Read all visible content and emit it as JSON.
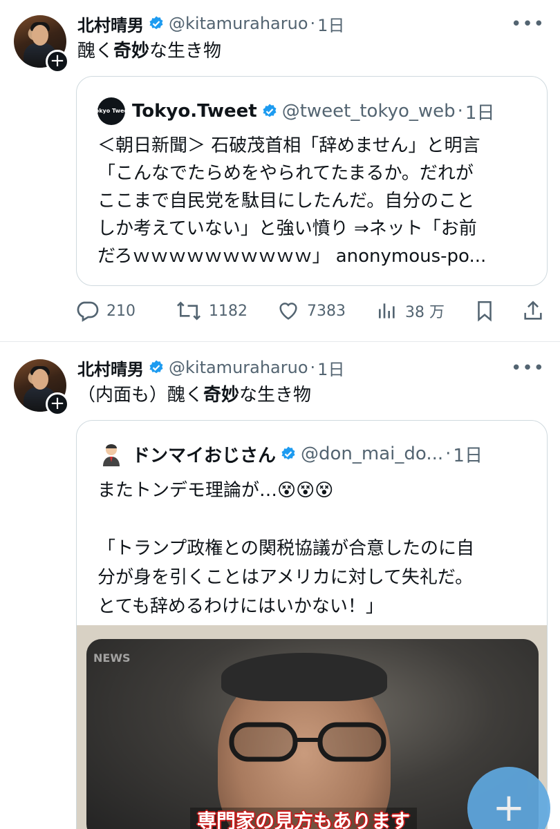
{
  "tweets": [
    {
      "author_name": "北村晴男",
      "handle": "@kitamuraharuo",
      "separator": "·",
      "time": "1日",
      "more": "•••",
      "text_a": "醜く",
      "text_b": "奇妙",
      "text_c": "な生き物",
      "quote": {
        "author_name": "Tokyo.Tweet",
        "avatar_text": "Tokyo Tweet",
        "handle": "@tweet_tokyo_web",
        "separator": "·",
        "time": "1日",
        "lines": [
          "＜朝日新聞＞ 石破茂首相「辞めません」と明言",
          "「こんなでたらめをやられてたまるか。だれが",
          "ここまで自民党を駄目にしたんだ。自分のこと",
          "しか考えていない」と強い憤り ⇒ネット「お前",
          "だろｗｗｗｗｗｗｗｗｗｗ」 anonymous-po..."
        ]
      },
      "actions": {
        "replies": "210",
        "reposts": "1182",
        "likes": "7383",
        "views": "38 万"
      }
    },
    {
      "author_name": "北村晴男",
      "handle": "@kitamuraharuo",
      "separator": "·",
      "time": "1日",
      "more": "•••",
      "text_a": "（内面も）醜く",
      "text_b": "奇妙",
      "text_c": "な生き物",
      "quote": {
        "author_name": "ドンマイおじさん",
        "handle": "@don_mai_do...",
        "separator": "·",
        "time": "1日",
        "lines": [
          "またトンデモ理論が…😵😵😵",
          "",
          "「トランプ政権との関税協議が合意したのに自",
          "分が身を引くことはアメリカに対して失礼だ。",
          "とても辞めるわけにはいかない！」"
        ],
        "video_logo": "NEWS",
        "video_caption": "専門家の見方もあります"
      }
    }
  ],
  "fab": {
    "label": "+"
  },
  "colors": {
    "accent": "#1d9bf0",
    "muted": "#536471",
    "border": "#cfd9de"
  }
}
